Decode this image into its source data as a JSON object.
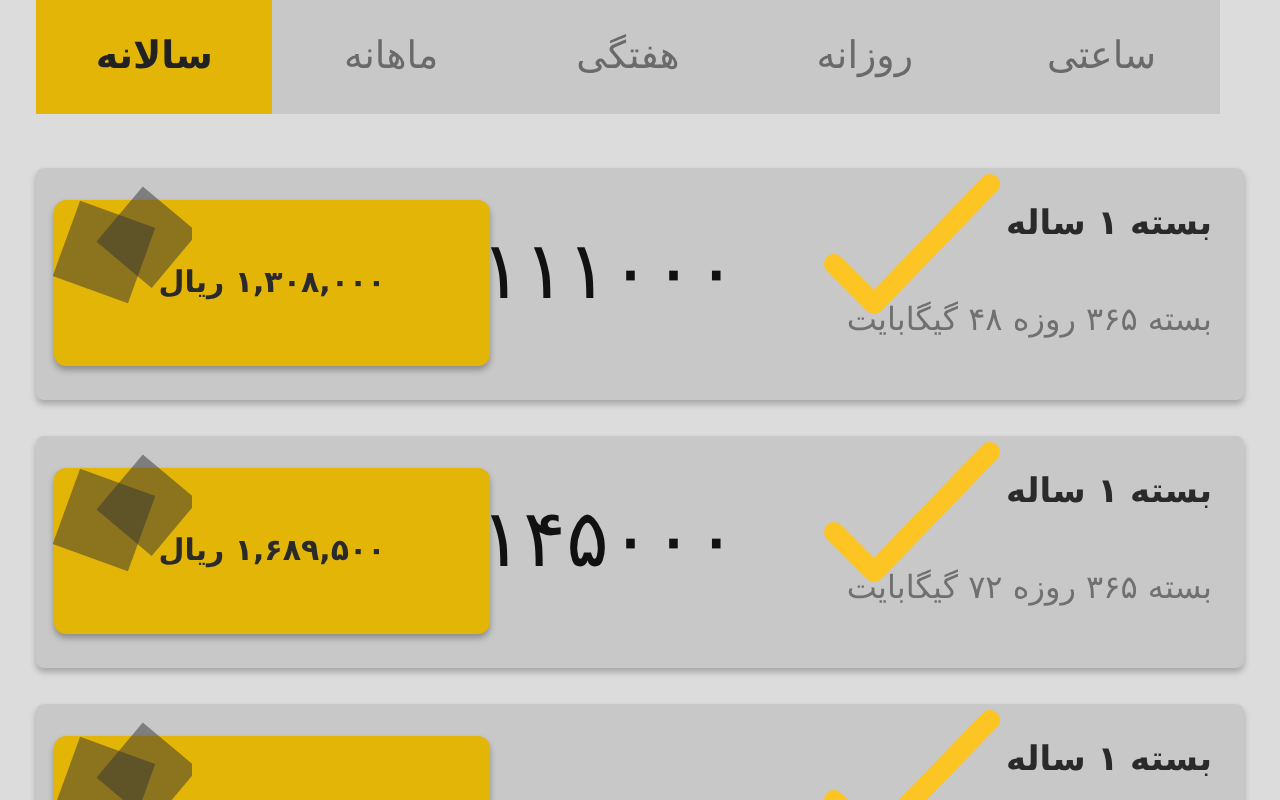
{
  "tabs": [
    {
      "label": "ساعتی",
      "selected": false
    },
    {
      "label": "روزانه",
      "selected": false
    },
    {
      "label": "هفتگی",
      "selected": false
    },
    {
      "label": "ماهانه",
      "selected": false
    },
    {
      "label": "سالانه",
      "selected": true
    }
  ],
  "packages": [
    {
      "title": "بسته ۱ ساله",
      "subtitle": "بسته ۳۶۵ روزه ۴۸ گیگابایت",
      "handwritten_number": "۱۱۱۰۰۰",
      "price": "۱,۳۰۸,۰۰۰ ریال"
    },
    {
      "title": "بسته ۱ ساله",
      "subtitle": "بسته ۳۶۵ روزه ۷۲ گیگابایت",
      "handwritten_number": "۱۴۵۰۰۰",
      "price": "۱,۶۸۹,۵۰۰ ریال"
    },
    {
      "title": "بسته ۱ ساله"
    }
  ]
}
